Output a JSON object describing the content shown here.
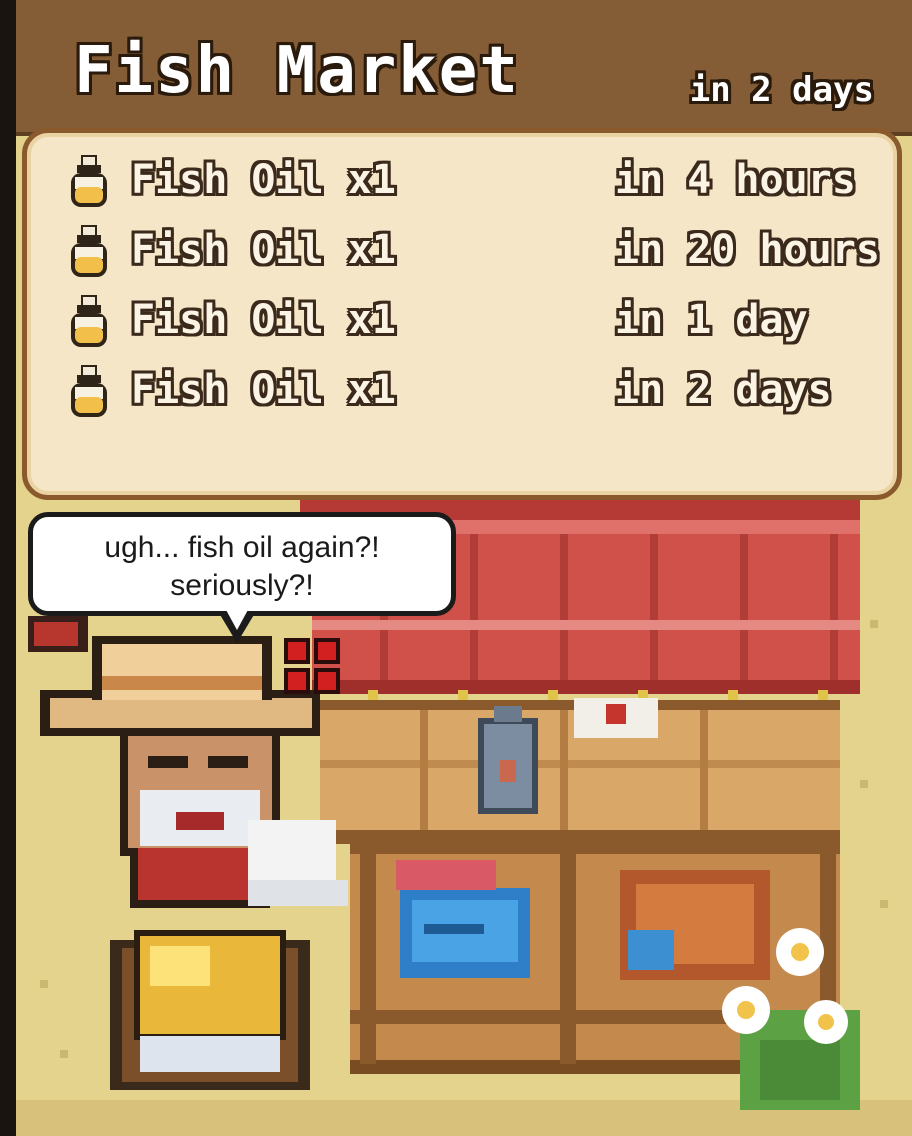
{
  "header": {
    "title": "Fish Market",
    "time": "in 2 days"
  },
  "orders": [
    {
      "item": "Fish Oil x1",
      "time": "in 4 hours",
      "icon": "potion-bottle-icon"
    },
    {
      "item": "Fish Oil x1",
      "time": "in 20 hours",
      "icon": "potion-bottle-icon"
    },
    {
      "item": "Fish Oil x1",
      "time": "in 1 day",
      "icon": "potion-bottle-icon"
    },
    {
      "item": "Fish Oil x1",
      "time": "in 2 days",
      "icon": "potion-bottle-icon"
    }
  ],
  "speech": {
    "line1": "ugh... fish oil again?!",
    "line2": "seriously?!"
  },
  "colors": {
    "header_bg": "#845d36",
    "panel_bg": "#f4e6c6",
    "panel_border": "#8a5a2c",
    "ground": "#e3d28c",
    "awning_red": "#cf4b45",
    "anger_mark": "#d21f1f"
  }
}
